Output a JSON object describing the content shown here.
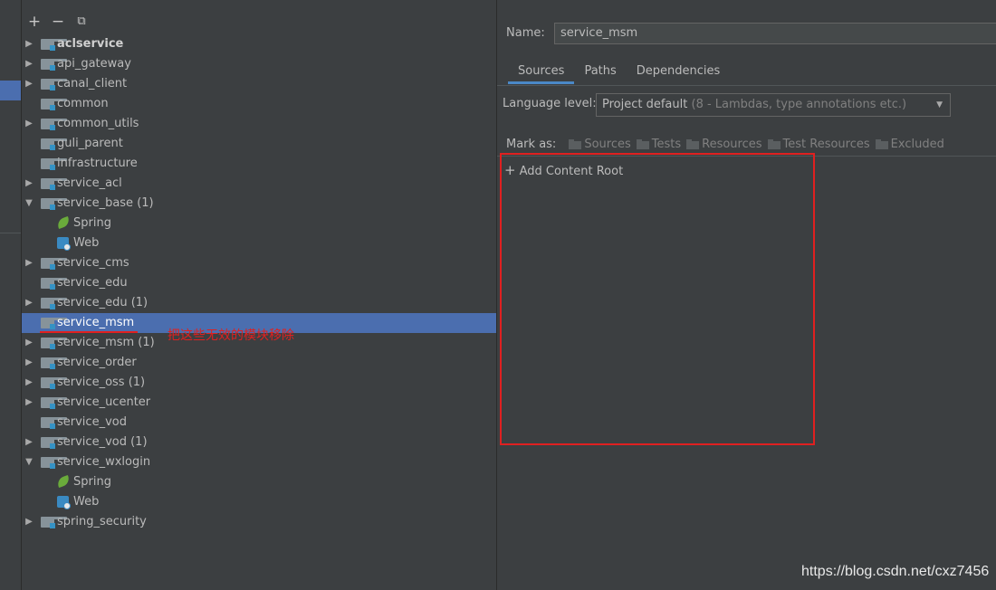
{
  "toolbar": {
    "add": "+",
    "remove": "−",
    "copy": "⧉"
  },
  "modules": [
    {
      "label": "aclservice",
      "arrow": "collapsed",
      "icon": "module-folder-icon",
      "bold": true,
      "indent": 0
    },
    {
      "label": "api_gateway",
      "arrow": "collapsed",
      "icon": "module-folder-icon",
      "indent": 0
    },
    {
      "label": "canal_client",
      "arrow": "collapsed",
      "icon": "module-folder-icon",
      "indent": 0
    },
    {
      "label": "common",
      "arrow": "none",
      "icon": "module-folder-icon",
      "indent": 0
    },
    {
      "label": "common_utils",
      "arrow": "collapsed",
      "icon": "module-folder-icon",
      "indent": 0
    },
    {
      "label": "guli_parent",
      "arrow": "none",
      "icon": "module-folder-icon",
      "indent": 0
    },
    {
      "label": "infrastructure",
      "arrow": "none",
      "icon": "module-folder-icon",
      "indent": 0
    },
    {
      "label": "service_acl",
      "arrow": "collapsed",
      "icon": "module-folder-icon",
      "indent": 0
    },
    {
      "label": "service_base (1)",
      "arrow": "expanded",
      "icon": "module-folder-icon",
      "indent": 0
    },
    {
      "label": "Spring",
      "arrow": "none",
      "icon": "spring-icon",
      "indent": 1
    },
    {
      "label": "Web",
      "arrow": "none",
      "icon": "web-icon",
      "indent": 1
    },
    {
      "label": "service_cms",
      "arrow": "collapsed",
      "icon": "module-folder-icon",
      "indent": 0
    },
    {
      "label": "service_edu",
      "arrow": "none",
      "icon": "module-folder-icon",
      "indent": 0
    },
    {
      "label": "service_edu (1)",
      "arrow": "collapsed",
      "icon": "module-folder-icon",
      "indent": 0
    },
    {
      "label": "service_msm",
      "arrow": "none",
      "icon": "module-folder-icon",
      "indent": 0,
      "selected": true
    },
    {
      "label": "service_msm (1)",
      "arrow": "collapsed",
      "icon": "module-folder-icon",
      "indent": 0
    },
    {
      "label": "service_order",
      "arrow": "collapsed",
      "icon": "module-folder-icon",
      "indent": 0
    },
    {
      "label": "service_oss (1)",
      "arrow": "collapsed",
      "icon": "module-folder-icon",
      "indent": 0
    },
    {
      "label": "service_ucenter",
      "arrow": "collapsed",
      "icon": "module-folder-icon",
      "indent": 0
    },
    {
      "label": "service_vod",
      "arrow": "none",
      "icon": "module-folder-icon",
      "indent": 0
    },
    {
      "label": "service_vod (1)",
      "arrow": "collapsed",
      "icon": "module-folder-icon",
      "indent": 0
    },
    {
      "label": "service_wxlogin",
      "arrow": "expanded",
      "icon": "module-folder-icon",
      "indent": 0
    },
    {
      "label": "Spring",
      "arrow": "none",
      "icon": "spring-icon",
      "indent": 1
    },
    {
      "label": "Web",
      "arrow": "none",
      "icon": "web-icon",
      "indent": 1
    },
    {
      "label": "spring_security",
      "arrow": "collapsed",
      "icon": "module-folder-icon",
      "indent": 0
    }
  ],
  "annotation": "把这些无效的模块移除",
  "details": {
    "name_label": "Name:",
    "name_value": "service_msm",
    "tabs": [
      "Sources",
      "Paths",
      "Dependencies"
    ],
    "active_tab": "Sources",
    "language_label": "Language level:",
    "language_value": "Project default",
    "language_hint": " (8 - Lambdas, type annotations etc.)",
    "mark_as_label": "Mark as:",
    "mark_as_items": [
      "Sources",
      "Tests",
      "Resources",
      "Test Resources",
      "Excluded"
    ],
    "add_content_root": "Add Content Root"
  },
  "watermark": "https://blog.csdn.net/cxz7456",
  "colors": {
    "selection": "#4b6eaf",
    "annotation": "#e02020",
    "background": "#3c3f41"
  }
}
